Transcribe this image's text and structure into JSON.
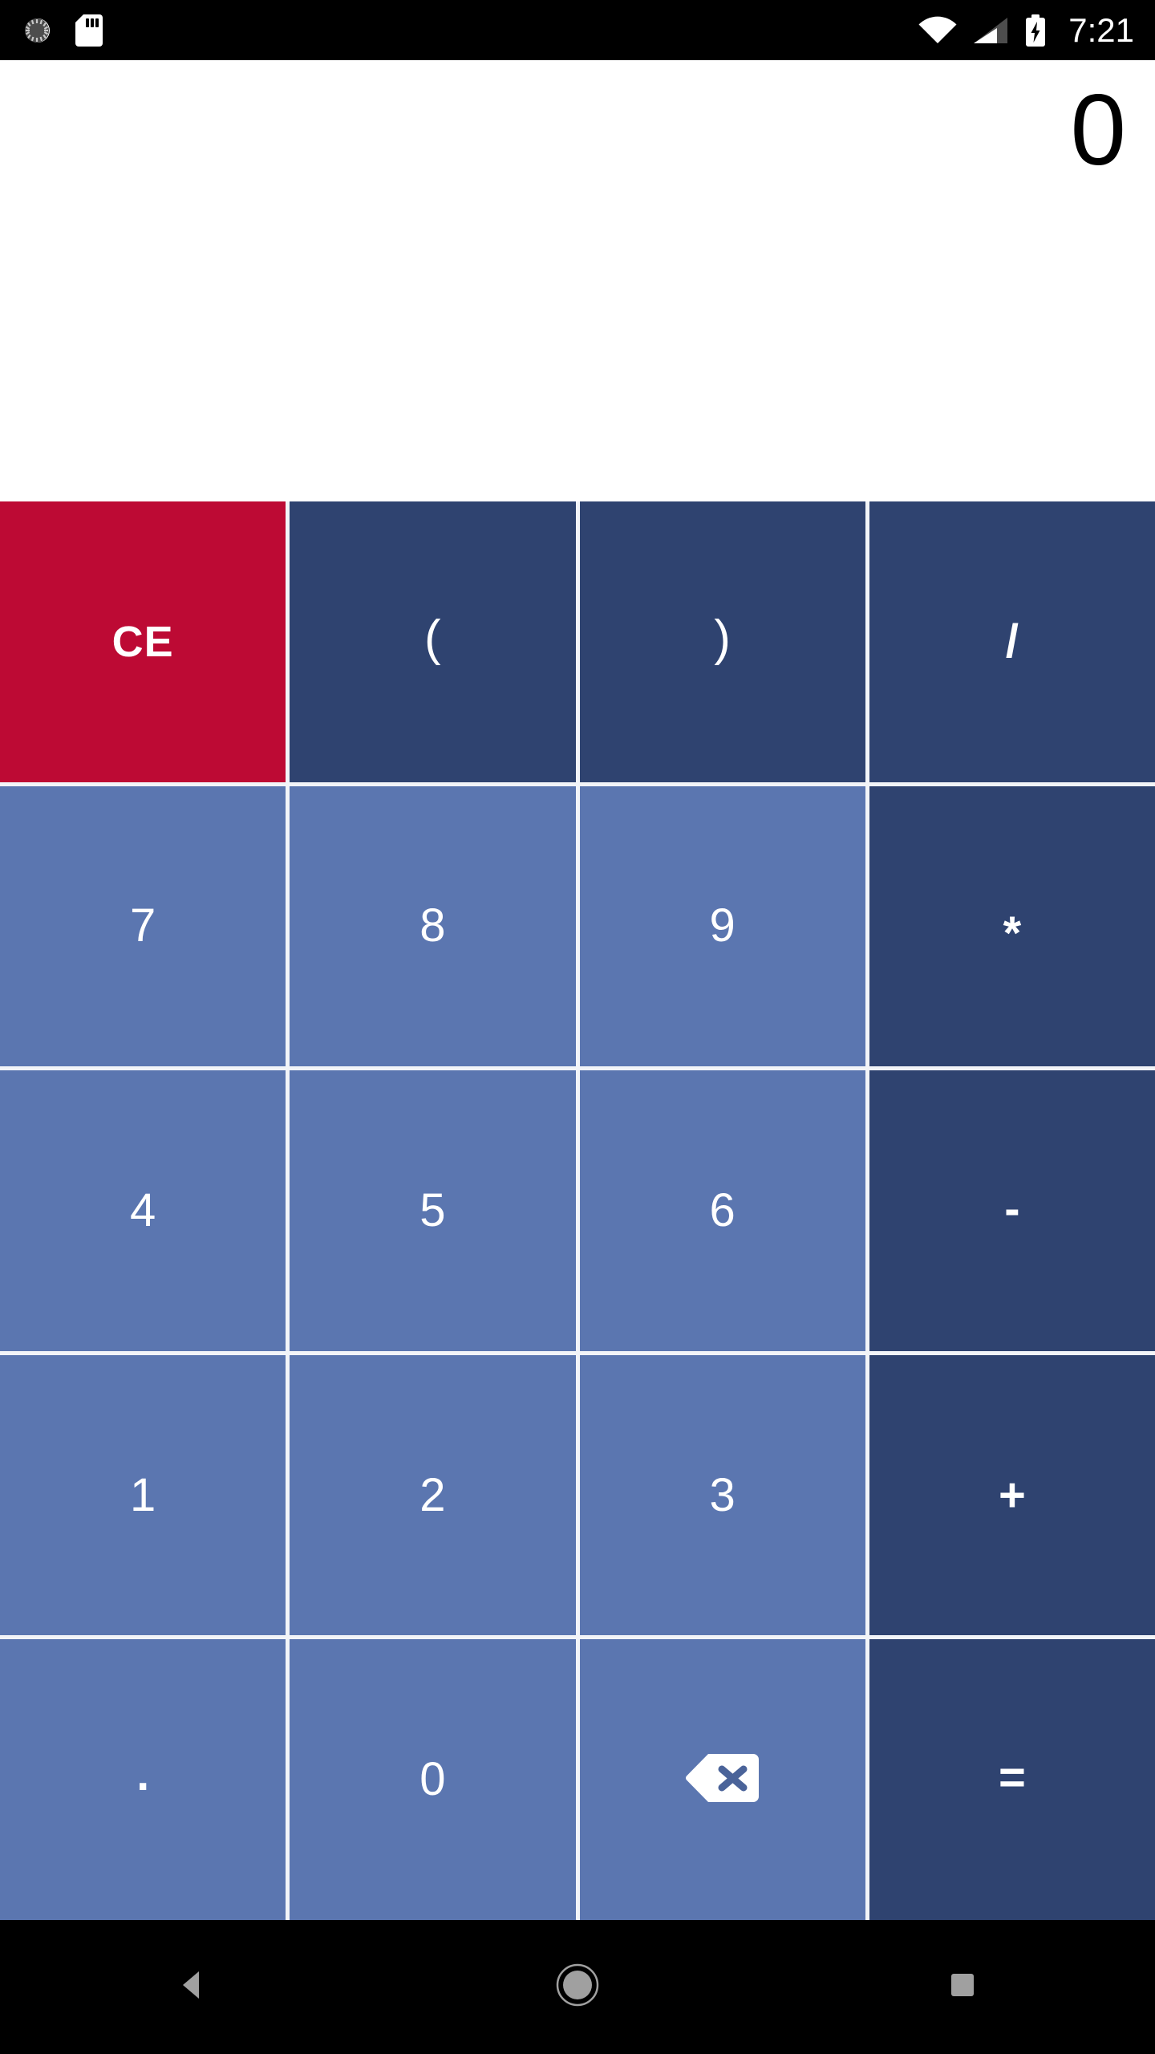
{
  "app": {
    "name": "Calculator"
  },
  "status_bar": {
    "background": "#000000",
    "clock": "7:21",
    "left_icons": [
      {
        "name": "sync-spinner-icon",
        "label": "sync"
      },
      {
        "name": "sd-card-icon",
        "label": "sd card"
      }
    ],
    "right_icons": [
      {
        "name": "wifi-icon",
        "label": "wifi"
      },
      {
        "name": "cellular-signal-icon",
        "label": "signal"
      },
      {
        "name": "battery-charging-icon",
        "label": "battery charging"
      }
    ]
  },
  "display": {
    "value": "0",
    "text_color": "#000000",
    "background": "#ffffff"
  },
  "colors": {
    "digit_key": "#5B76B0",
    "operator_key": "#2F4370",
    "clear_key": "#BD0A34",
    "key_text": "#ffffff",
    "grid_line": "#ffffff",
    "nav_icon": "#A0A0A0"
  },
  "keypad": {
    "rows": [
      [
        {
          "id": "ce",
          "label": "CE",
          "kind": "clear",
          "name": "clear-entry-button"
        },
        {
          "id": "lparen",
          "label": "(",
          "kind": "paren",
          "name": "left-parenthesis-button"
        },
        {
          "id": "rparen",
          "label": ")",
          "kind": "paren",
          "name": "right-parenthesis-button"
        },
        {
          "id": "divide",
          "label": "/",
          "kind": "operator",
          "name": "divide-button"
        }
      ],
      [
        {
          "id": "seven",
          "label": "7",
          "kind": "digit",
          "name": "digit-7-button"
        },
        {
          "id": "eight",
          "label": "8",
          "kind": "digit",
          "name": "digit-8-button"
        },
        {
          "id": "nine",
          "label": "9",
          "kind": "digit",
          "name": "digit-9-button"
        },
        {
          "id": "multiply",
          "label": "*",
          "kind": "operator",
          "name": "multiply-button"
        }
      ],
      [
        {
          "id": "four",
          "label": "4",
          "kind": "digit",
          "name": "digit-4-button"
        },
        {
          "id": "five",
          "label": "5",
          "kind": "digit",
          "name": "digit-5-button"
        },
        {
          "id": "six",
          "label": "6",
          "kind": "digit",
          "name": "digit-6-button"
        },
        {
          "id": "subtract",
          "label": "-",
          "kind": "operator",
          "name": "subtract-button"
        }
      ],
      [
        {
          "id": "one",
          "label": "1",
          "kind": "digit",
          "name": "digit-1-button"
        },
        {
          "id": "two",
          "label": "2",
          "kind": "digit",
          "name": "digit-2-button"
        },
        {
          "id": "three",
          "label": "3",
          "kind": "digit",
          "name": "digit-3-button"
        },
        {
          "id": "add",
          "label": "+",
          "kind": "operator",
          "name": "add-button"
        }
      ],
      [
        {
          "id": "decimal",
          "label": ".",
          "kind": "dot",
          "name": "decimal-point-button"
        },
        {
          "id": "zero",
          "label": "0",
          "kind": "digit",
          "name": "digit-0-button"
        },
        {
          "id": "backspace",
          "label": "",
          "kind": "backspace",
          "name": "backspace-button",
          "icon": "backspace-icon"
        },
        {
          "id": "equals",
          "label": "=",
          "kind": "operator",
          "name": "equals-button"
        }
      ]
    ]
  },
  "nav_bar": {
    "background": "#000000",
    "buttons": [
      {
        "id": "back",
        "name": "nav-back-button",
        "icon": "back-triangle-icon"
      },
      {
        "id": "home",
        "name": "nav-home-button",
        "icon": "home-circle-icon"
      },
      {
        "id": "recents",
        "name": "nav-recents-button",
        "icon": "recents-square-icon"
      }
    ]
  }
}
